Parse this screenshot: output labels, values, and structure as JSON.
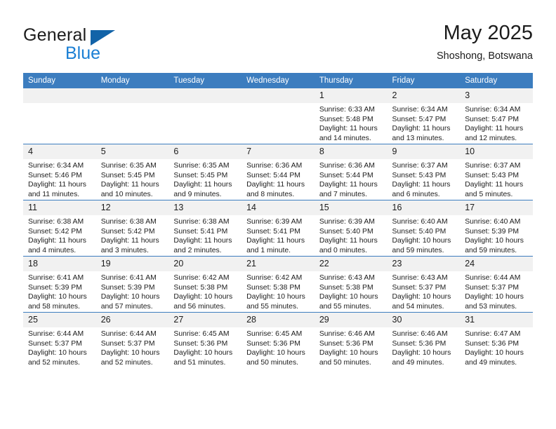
{
  "brand": {
    "word1": "General",
    "word2": "Blue",
    "triangle_color": "#1263a8",
    "blue_color": "#1b7fd4"
  },
  "header": {
    "title": "May 2025",
    "subtitle": "Shoshong, Botswana"
  },
  "theme": {
    "header_row_bg": "#3c7dbf",
    "daynum_bg": "#f1f1f1",
    "text": "#1c1c1c"
  },
  "weekday_headers": [
    "Sunday",
    "Monday",
    "Tuesday",
    "Wednesday",
    "Thursday",
    "Friday",
    "Saturday"
  ],
  "weeks": [
    [
      {
        "day": "",
        "lines": []
      },
      {
        "day": "",
        "lines": []
      },
      {
        "day": "",
        "lines": []
      },
      {
        "day": "",
        "lines": []
      },
      {
        "day": "1",
        "lines": [
          "Sunrise: 6:33 AM",
          "Sunset: 5:48 PM",
          "Daylight: 11 hours",
          "and 14 minutes."
        ]
      },
      {
        "day": "2",
        "lines": [
          "Sunrise: 6:34 AM",
          "Sunset: 5:47 PM",
          "Daylight: 11 hours",
          "and 13 minutes."
        ]
      },
      {
        "day": "3",
        "lines": [
          "Sunrise: 6:34 AM",
          "Sunset: 5:47 PM",
          "Daylight: 11 hours",
          "and 12 minutes."
        ]
      }
    ],
    [
      {
        "day": "4",
        "lines": [
          "Sunrise: 6:34 AM",
          "Sunset: 5:46 PM",
          "Daylight: 11 hours",
          "and 11 minutes."
        ]
      },
      {
        "day": "5",
        "lines": [
          "Sunrise: 6:35 AM",
          "Sunset: 5:45 PM",
          "Daylight: 11 hours",
          "and 10 minutes."
        ]
      },
      {
        "day": "6",
        "lines": [
          "Sunrise: 6:35 AM",
          "Sunset: 5:45 PM",
          "Daylight: 11 hours",
          "and 9 minutes."
        ]
      },
      {
        "day": "7",
        "lines": [
          "Sunrise: 6:36 AM",
          "Sunset: 5:44 PM",
          "Daylight: 11 hours",
          "and 8 minutes."
        ]
      },
      {
        "day": "8",
        "lines": [
          "Sunrise: 6:36 AM",
          "Sunset: 5:44 PM",
          "Daylight: 11 hours",
          "and 7 minutes."
        ]
      },
      {
        "day": "9",
        "lines": [
          "Sunrise: 6:37 AM",
          "Sunset: 5:43 PM",
          "Daylight: 11 hours",
          "and 6 minutes."
        ]
      },
      {
        "day": "10",
        "lines": [
          "Sunrise: 6:37 AM",
          "Sunset: 5:43 PM",
          "Daylight: 11 hours",
          "and 5 minutes."
        ]
      }
    ],
    [
      {
        "day": "11",
        "lines": [
          "Sunrise: 6:38 AM",
          "Sunset: 5:42 PM",
          "Daylight: 11 hours",
          "and 4 minutes."
        ]
      },
      {
        "day": "12",
        "lines": [
          "Sunrise: 6:38 AM",
          "Sunset: 5:42 PM",
          "Daylight: 11 hours",
          "and 3 minutes."
        ]
      },
      {
        "day": "13",
        "lines": [
          "Sunrise: 6:38 AM",
          "Sunset: 5:41 PM",
          "Daylight: 11 hours",
          "and 2 minutes."
        ]
      },
      {
        "day": "14",
        "lines": [
          "Sunrise: 6:39 AM",
          "Sunset: 5:41 PM",
          "Daylight: 11 hours",
          "and 1 minute."
        ]
      },
      {
        "day": "15",
        "lines": [
          "Sunrise: 6:39 AM",
          "Sunset: 5:40 PM",
          "Daylight: 11 hours",
          "and 0 minutes."
        ]
      },
      {
        "day": "16",
        "lines": [
          "Sunrise: 6:40 AM",
          "Sunset: 5:40 PM",
          "Daylight: 10 hours",
          "and 59 minutes."
        ]
      },
      {
        "day": "17",
        "lines": [
          "Sunrise: 6:40 AM",
          "Sunset: 5:39 PM",
          "Daylight: 10 hours",
          "and 59 minutes."
        ]
      }
    ],
    [
      {
        "day": "18",
        "lines": [
          "Sunrise: 6:41 AM",
          "Sunset: 5:39 PM",
          "Daylight: 10 hours",
          "and 58 minutes."
        ]
      },
      {
        "day": "19",
        "lines": [
          "Sunrise: 6:41 AM",
          "Sunset: 5:39 PM",
          "Daylight: 10 hours",
          "and 57 minutes."
        ]
      },
      {
        "day": "20",
        "lines": [
          "Sunrise: 6:42 AM",
          "Sunset: 5:38 PM",
          "Daylight: 10 hours",
          "and 56 minutes."
        ]
      },
      {
        "day": "21",
        "lines": [
          "Sunrise: 6:42 AM",
          "Sunset: 5:38 PM",
          "Daylight: 10 hours",
          "and 55 minutes."
        ]
      },
      {
        "day": "22",
        "lines": [
          "Sunrise: 6:43 AM",
          "Sunset: 5:38 PM",
          "Daylight: 10 hours",
          "and 55 minutes."
        ]
      },
      {
        "day": "23",
        "lines": [
          "Sunrise: 6:43 AM",
          "Sunset: 5:37 PM",
          "Daylight: 10 hours",
          "and 54 minutes."
        ]
      },
      {
        "day": "24",
        "lines": [
          "Sunrise: 6:44 AM",
          "Sunset: 5:37 PM",
          "Daylight: 10 hours",
          "and 53 minutes."
        ]
      }
    ],
    [
      {
        "day": "25",
        "lines": [
          "Sunrise: 6:44 AM",
          "Sunset: 5:37 PM",
          "Daylight: 10 hours",
          "and 52 minutes."
        ]
      },
      {
        "day": "26",
        "lines": [
          "Sunrise: 6:44 AM",
          "Sunset: 5:37 PM",
          "Daylight: 10 hours",
          "and 52 minutes."
        ]
      },
      {
        "day": "27",
        "lines": [
          "Sunrise: 6:45 AM",
          "Sunset: 5:36 PM",
          "Daylight: 10 hours",
          "and 51 minutes."
        ]
      },
      {
        "day": "28",
        "lines": [
          "Sunrise: 6:45 AM",
          "Sunset: 5:36 PM",
          "Daylight: 10 hours",
          "and 50 minutes."
        ]
      },
      {
        "day": "29",
        "lines": [
          "Sunrise: 6:46 AM",
          "Sunset: 5:36 PM",
          "Daylight: 10 hours",
          "and 50 minutes."
        ]
      },
      {
        "day": "30",
        "lines": [
          "Sunrise: 6:46 AM",
          "Sunset: 5:36 PM",
          "Daylight: 10 hours",
          "and 49 minutes."
        ]
      },
      {
        "day": "31",
        "lines": [
          "Sunrise: 6:47 AM",
          "Sunset: 5:36 PM",
          "Daylight: 10 hours",
          "and 49 minutes."
        ]
      }
    ]
  ]
}
